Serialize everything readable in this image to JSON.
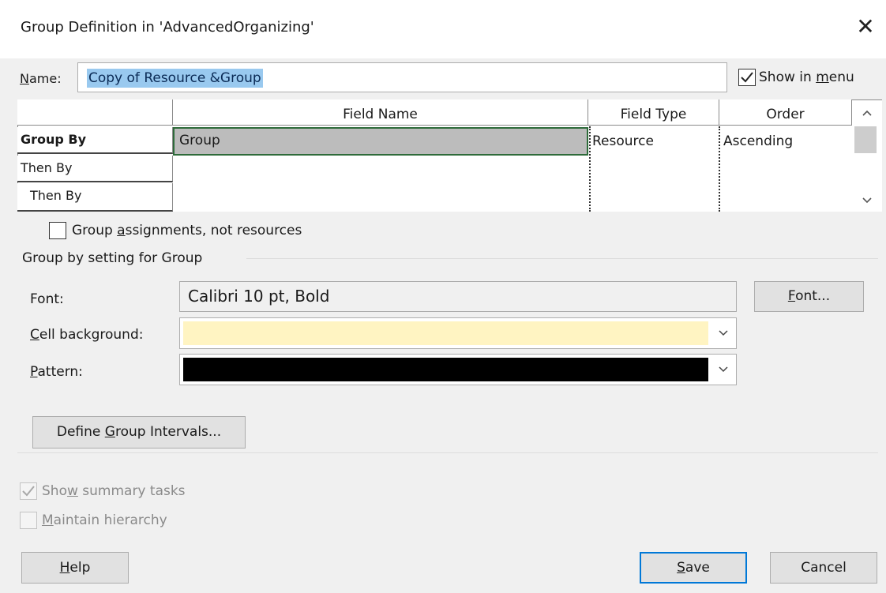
{
  "window": {
    "title": "Group Definition in 'AdvancedOrganizing'",
    "close_glyph": "✕"
  },
  "name": {
    "label_prefix": "",
    "label_key": "N",
    "label_rest": "ame:",
    "value": "Copy of Resource &Group"
  },
  "show_in_menu": {
    "checked": true,
    "label_pre": "Show in ",
    "label_key": "m",
    "label_post": "enu"
  },
  "grid": {
    "columns": [
      "Field Name",
      "Field Type",
      "Order"
    ],
    "rows": [
      {
        "header": "Group By",
        "field_name": "Group",
        "field_type": "Resource",
        "order": "Ascending"
      },
      {
        "header": "Then By",
        "field_name": "",
        "field_type": "",
        "order": ""
      },
      {
        "header": "Then By",
        "field_name": "",
        "field_type": "",
        "order": ""
      }
    ],
    "scroll_up_icon": "chevron-up",
    "scroll_down_icon": "chevron-down"
  },
  "group_assignments": {
    "checked": false,
    "label_pre": "Group ",
    "label_key": "a",
    "label_post": "ssignments, not resources"
  },
  "group_setting": {
    "title": "Group by setting for Group",
    "font_label": "Font:",
    "font_value": "Calibri 10 pt, Bold",
    "font_button_key": "F",
    "font_button_rest": "ont...",
    "cell_bg_label_key": "C",
    "cell_bg_label_rest": "ell background:",
    "cell_bg_color": "#fff4c2",
    "pattern_label_key": "P",
    "pattern_label_rest": "attern:",
    "pattern_color": "#000000"
  },
  "define_intervals": {
    "label_pre": "Define ",
    "label_key": "G",
    "label_post": "roup Intervals..."
  },
  "show_summary": {
    "checked": true,
    "enabled": false,
    "label_pre": "Sho",
    "label_key": "w",
    "label_post": " summary tasks"
  },
  "maintain_hierarchy": {
    "checked": false,
    "enabled": false,
    "label_key": "M",
    "label_rest": "aintain hierarchy"
  },
  "buttons": {
    "help_key": "H",
    "help_rest": "elp",
    "save_key": "S",
    "save_rest": "ave",
    "cancel": "Cancel"
  },
  "colors": {
    "selection_highlight": "#99c9ef",
    "selected_cell_border": "#2e6b3a",
    "default_button_border": "#0078d7"
  }
}
